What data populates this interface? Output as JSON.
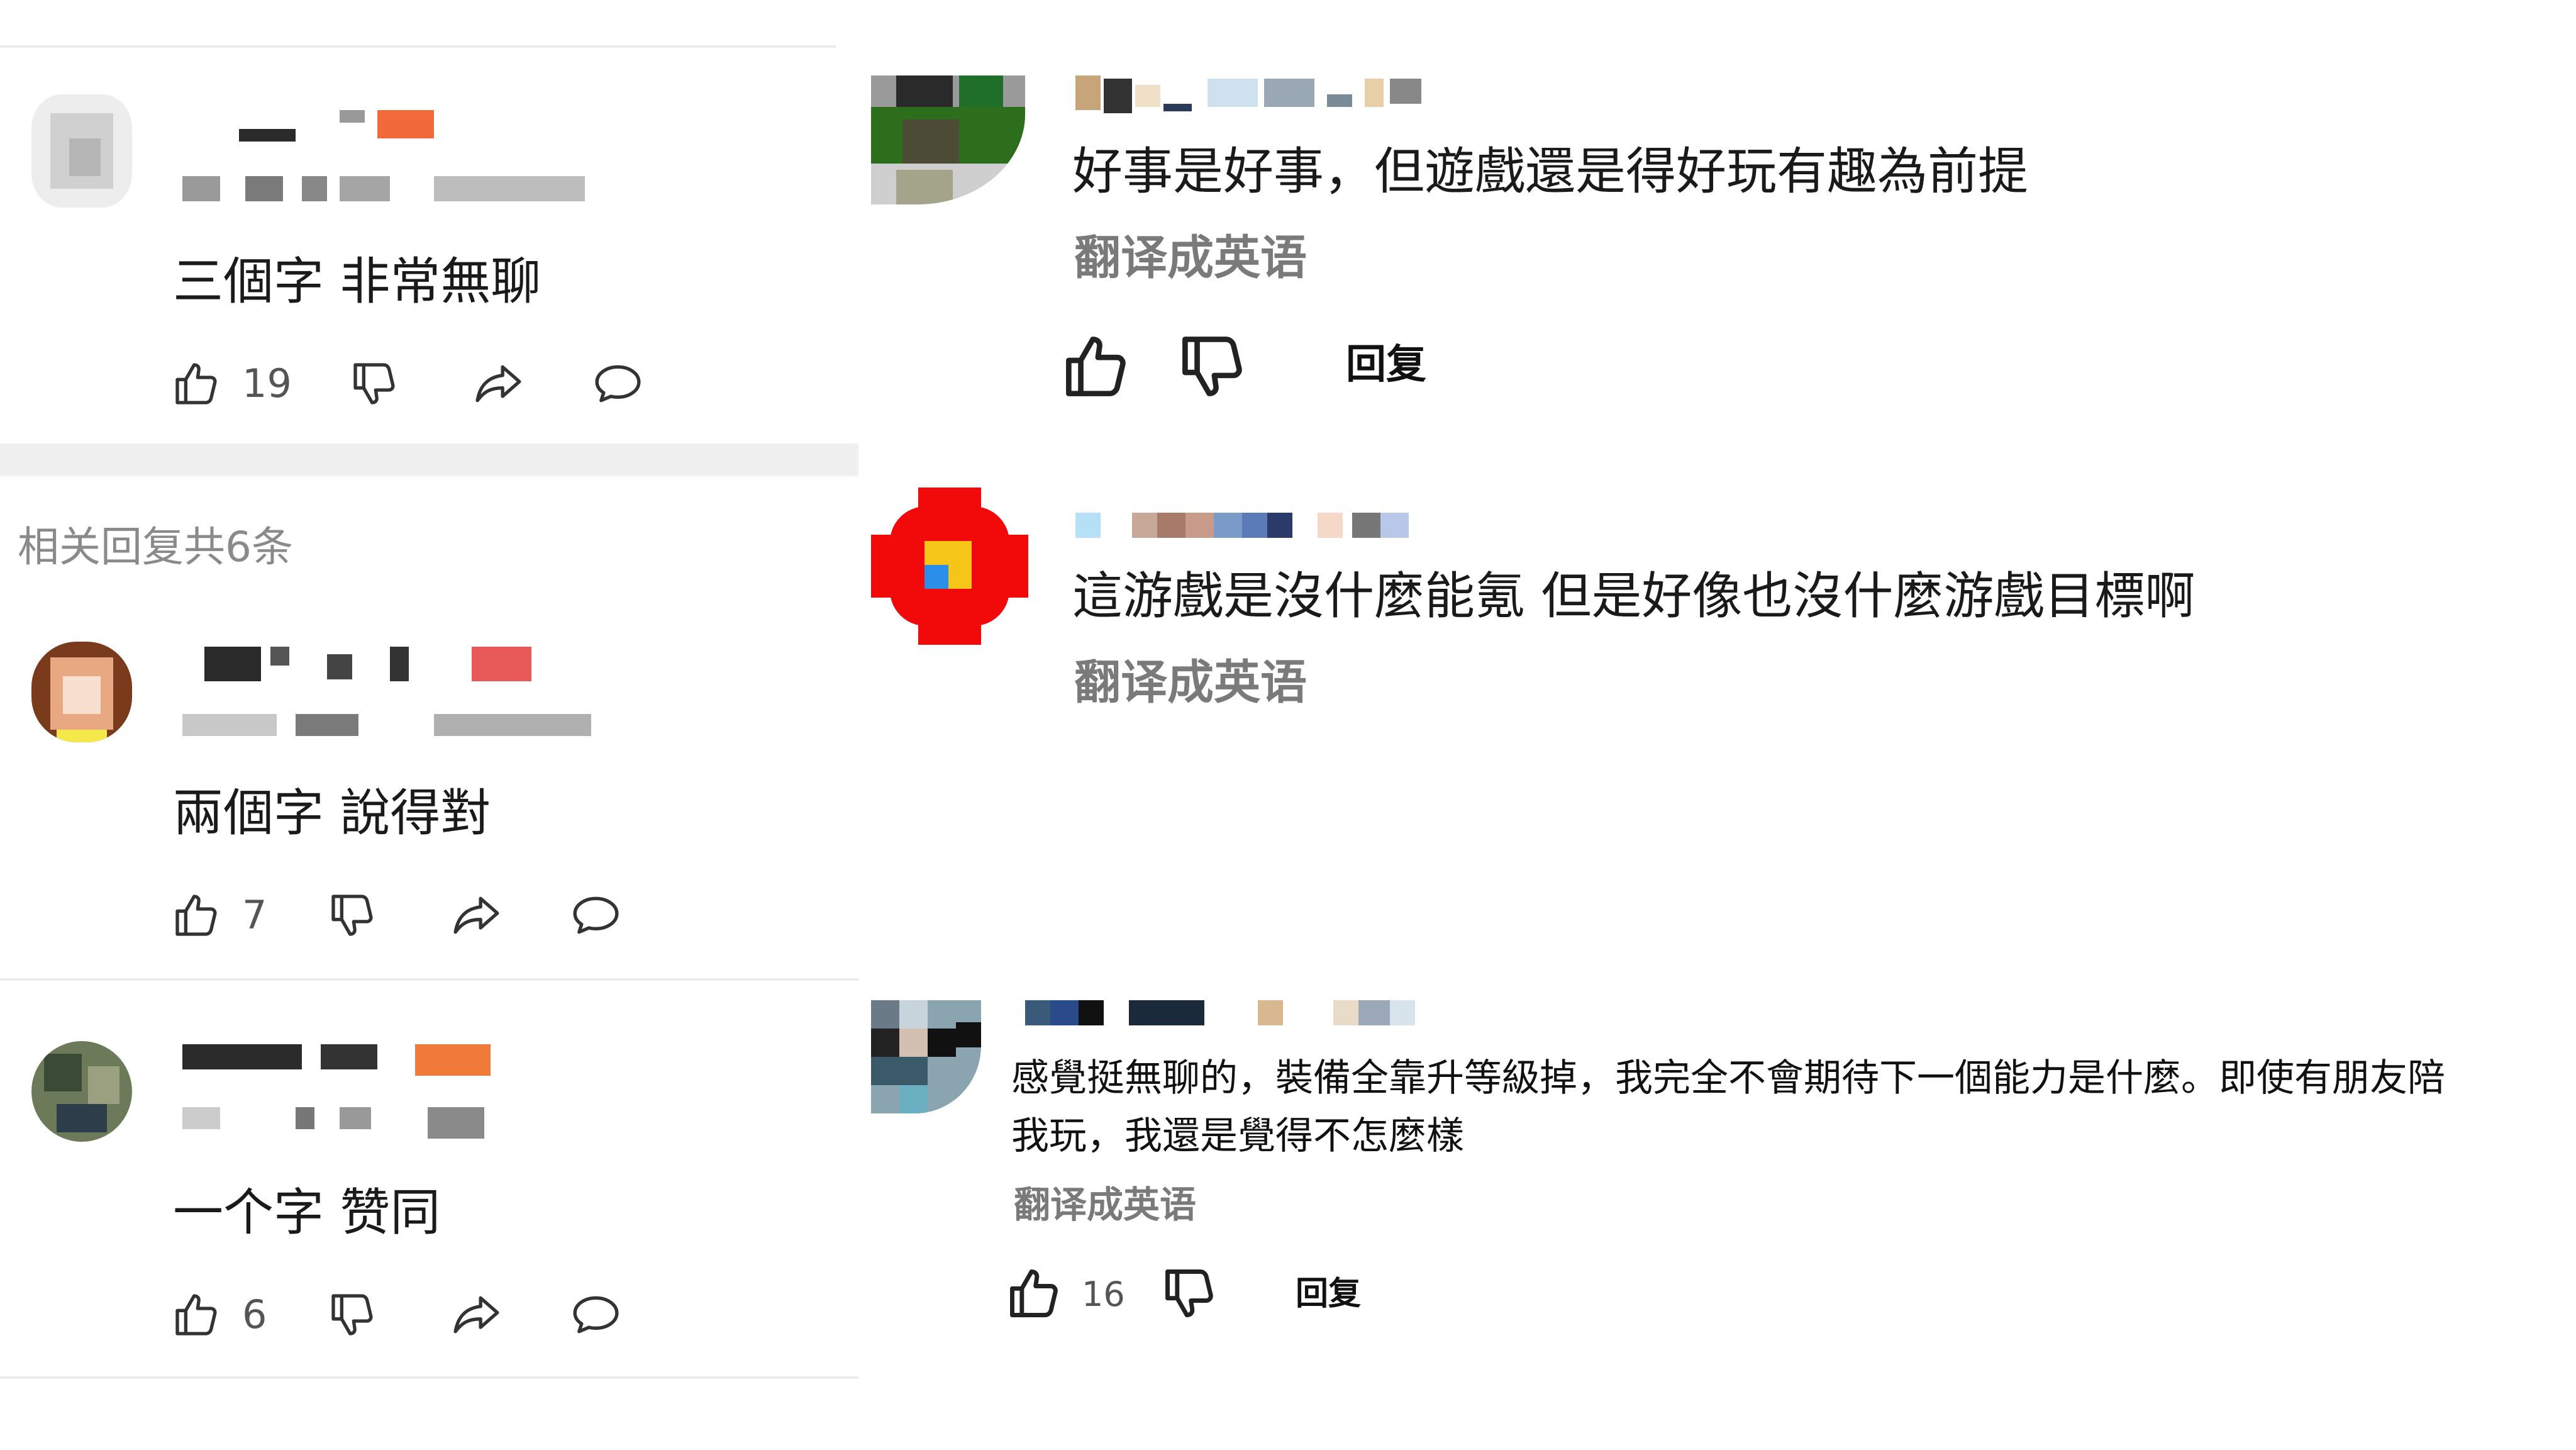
{
  "left_panel": {
    "comment_1": {
      "text": "三個字 非常無聊",
      "likes": "19"
    },
    "related_replies_label": "相关回复共6条",
    "comment_2": {
      "text": "兩個字 說得對",
      "likes": "7"
    },
    "comment_3": {
      "text": "一个字 赞同",
      "likes": "6"
    }
  },
  "right_panel": {
    "comment_a": {
      "text": "好事是好事，但遊戲還是得好玩有趣為前提",
      "translate": "翻译成英语",
      "reply": "回复"
    },
    "comment_b": {
      "text": "這游戲是沒什麼能氪 但是好像也沒什麼游戲目標啊",
      "translate": "翻译成英语"
    },
    "comment_c": {
      "text_line1": "感覺挺無聊的，裝備全靠升等級掉，我完全不會期待下一個能力是什麼。即使有朋友陪",
      "text_line2": "我玩，我還是覺得不怎麼樣",
      "translate": "翻译成英语",
      "likes": "16",
      "reply": "回复"
    }
  },
  "icons": [
    "thumbs-up-icon",
    "thumbs-down-icon",
    "share-icon",
    "comment-icon"
  ],
  "colors": {
    "divider": "#ececec",
    "muted_text": "#7a7a7a",
    "body_text": "#1a1a1a"
  }
}
